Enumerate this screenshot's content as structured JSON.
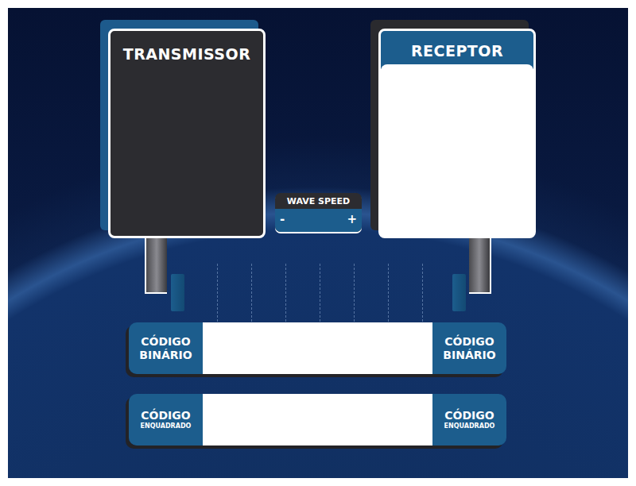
{
  "transmitter": {
    "title": "TRANSMISSOR"
  },
  "receiver": {
    "title": "RECEPTOR"
  },
  "wave_speed": {
    "label": "WAVE SPEED",
    "decrease": "-",
    "increase": "+"
  },
  "code_bars": [
    {
      "kind": "binary",
      "title": "CÓDIGO",
      "subtitle": "BINÁRIO",
      "value": ""
    },
    {
      "kind": "framed",
      "title": "CÓDIGO",
      "subtitle": "ENQUADRADO",
      "value": ""
    }
  ]
}
